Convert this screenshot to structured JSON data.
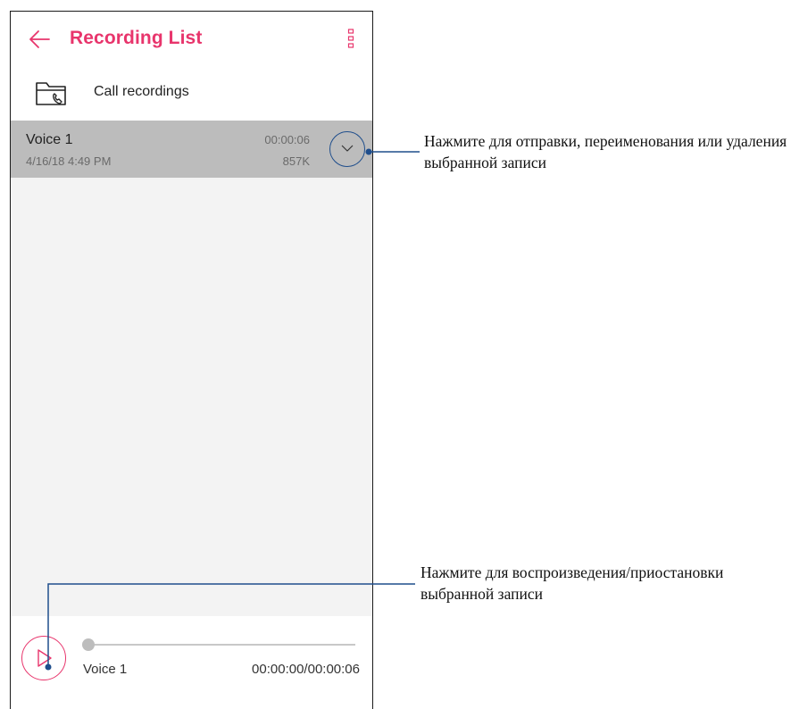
{
  "appbar": {
    "title": "Recording List",
    "back_icon": "arrow-left-icon",
    "menu_icon": "more-vertical-icon"
  },
  "folder": {
    "label": "Call recordings",
    "icon": "folder-phone-icon"
  },
  "recording": {
    "name": "Voice 1",
    "date": "4/16/18 4:49 PM",
    "duration": "00:00:06",
    "size": "857K",
    "expand_icon": "chevron-down-icon"
  },
  "player": {
    "name": "Voice 1",
    "time": "00:00:00/00:00:06",
    "progress": 0,
    "play_icon": "play-icon"
  },
  "annotations": {
    "expand_note": "Нажмите для отправки, переименования или удаления выбранной записи",
    "play_note": "Нажмите для воспроизведения/приостановки выбранной записи"
  },
  "colors": {
    "accent": "#e8356c",
    "callout_line": "#1f4e8c",
    "selected_row": "#bcbcbc",
    "list_background": "#f3f3f3"
  }
}
